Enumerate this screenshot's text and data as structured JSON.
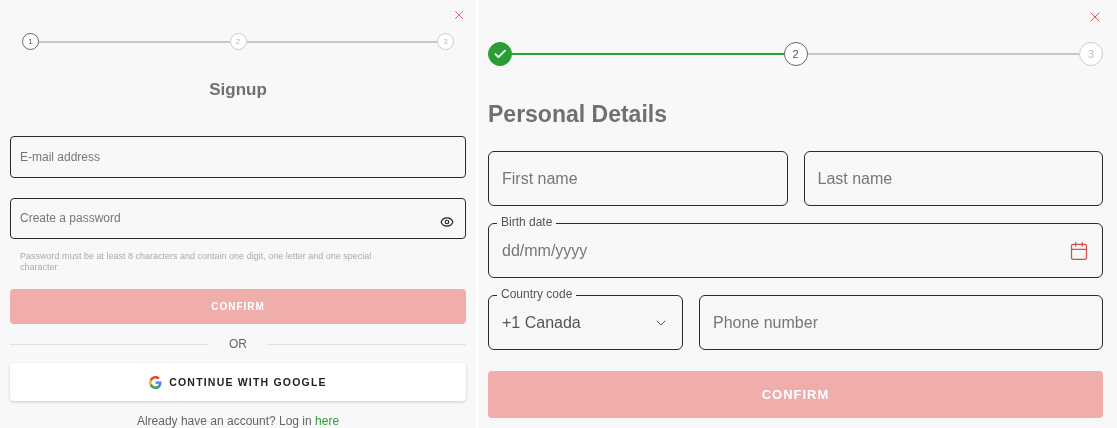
{
  "signup": {
    "steps": [
      {
        "label": "1",
        "done": false,
        "selected": true
      },
      {
        "label": "2",
        "done": false,
        "selected": false
      },
      {
        "label": "3",
        "done": false,
        "selected": false
      }
    ],
    "title": "Signup",
    "fields": [
      {
        "kind": "text",
        "placeholder": "E-mail address"
      },
      {
        "kind": "password",
        "placeholder": "Create a password"
      }
    ],
    "hint": "Password must be at least 8 characters and contain one digit, one letter and one special character",
    "confirm": {
      "label": "CONFIRM",
      "disabled": true
    },
    "divider": "OR",
    "google": "CONTINUE WITH GOOGLE",
    "footer": {
      "text": "Already have an account? Log in",
      "link": "here"
    }
  },
  "details": {
    "steps": [
      {
        "done": true,
        "selected": false
      },
      {
        "label": "2",
        "done": false,
        "selected": true
      },
      {
        "label": "3",
        "done": false,
        "selected": false
      }
    ],
    "title": "Personal Details",
    "rows": [
      [
        {
          "kind": "text",
          "placeholder": "First name"
        },
        {
          "kind": "text",
          "placeholder": "Last name"
        }
      ],
      [
        {
          "kind": "date",
          "label": "Birth date",
          "placeholder": "dd/mm/yyyy"
        }
      ],
      [
        {
          "kind": "select",
          "label": "Country code",
          "value": "+1 Canada"
        },
        {
          "kind": "text",
          "placeholder": "Phone number"
        }
      ]
    ],
    "confirm": {
      "label": "CONFIRM",
      "disabled": true
    }
  }
}
